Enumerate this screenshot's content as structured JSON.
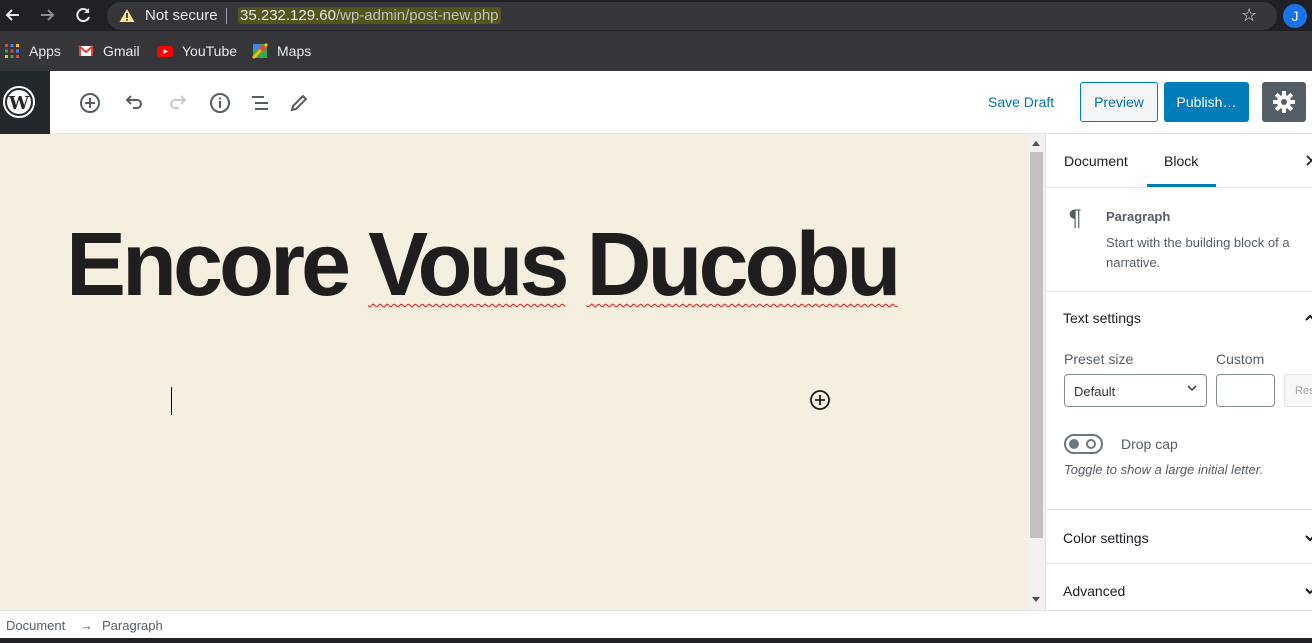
{
  "browser": {
    "not_secure_label": "Not secure",
    "url_host": "35.232.129.60",
    "url_path": "/wp-admin/post-new.php",
    "profile_initial": "J"
  },
  "bookmarks": [
    {
      "label": "Apps",
      "icon": "apps-grid-icon"
    },
    {
      "label": "Gmail",
      "icon": "gmail-icon"
    },
    {
      "label": "YouTube",
      "icon": "youtube-icon"
    },
    {
      "label": "Maps",
      "icon": "maps-icon"
    }
  ],
  "toolbar": {
    "save_draft": "Save Draft",
    "preview": "Preview",
    "publish": "Publish…"
  },
  "editor": {
    "title_words": [
      "Encore",
      "Vous",
      "Ducobu"
    ]
  },
  "sidebar": {
    "tabs": [
      "Document",
      "Block"
    ],
    "active_tab": "Block",
    "block_name": "Paragraph",
    "block_description_line1": "Start with the building block of a",
    "block_description_line2": "narrative.",
    "text_settings_title": "Text settings",
    "preset_size_label": "Preset size",
    "custom_label": "Custom",
    "preset_value": "Default",
    "reset_label": "Reset",
    "drop_cap_label": "Drop cap",
    "drop_cap_help": "Toggle to show a large initial letter.",
    "color_settings_title": "Color settings",
    "advanced_title": "Advanced"
  },
  "footer": {
    "crumbs": [
      "Document",
      "→",
      "Paragraph"
    ]
  },
  "colors": {
    "accent": "#007cba",
    "editor_bg": "#f5efe0",
    "chrome_dark": "#202124"
  }
}
